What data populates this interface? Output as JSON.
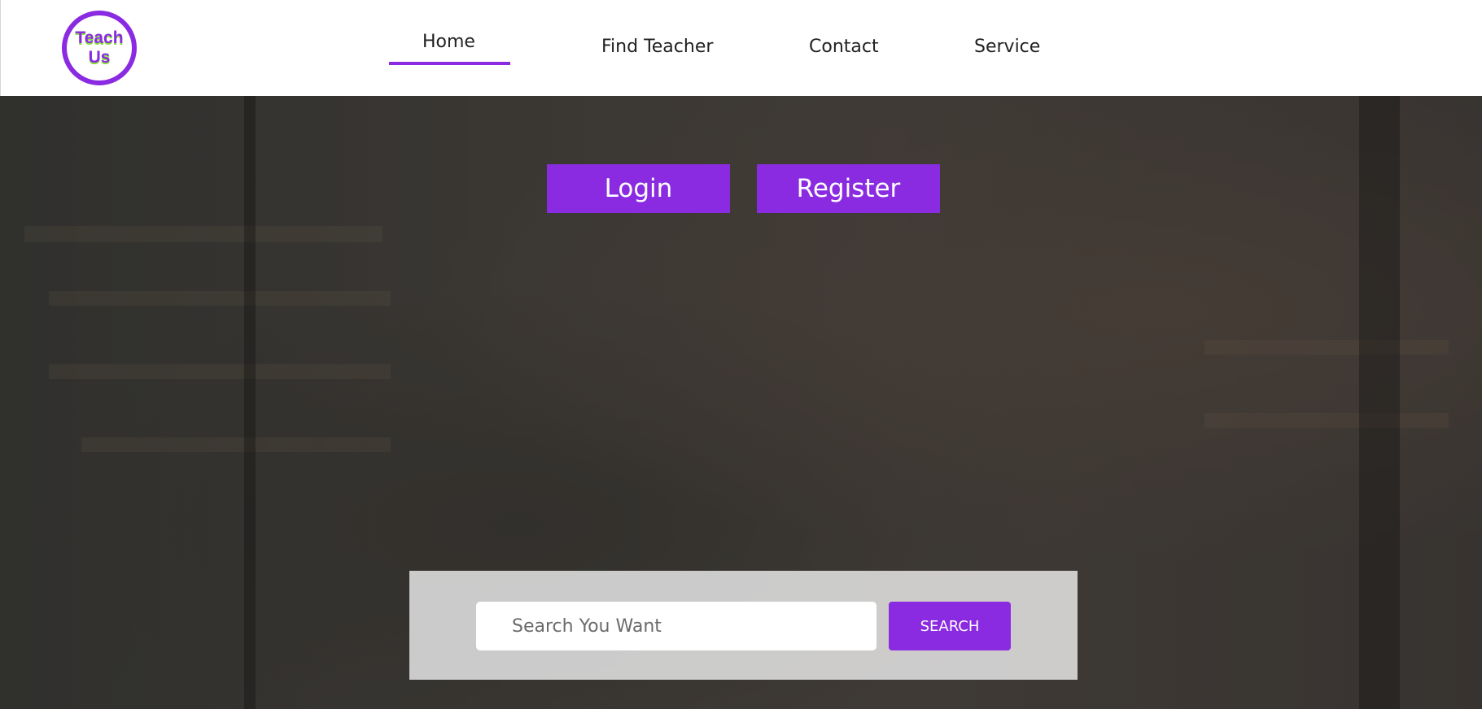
{
  "brand": {
    "logo_line1": "Teach",
    "logo_line2": "Us",
    "primary_color": "#8a2be2",
    "logo_accent_color": "#8bd93a"
  },
  "nav": {
    "items": [
      {
        "label": "Home",
        "active": true
      },
      {
        "label": "Find Teacher",
        "active": false
      },
      {
        "label": "Contact",
        "active": false
      },
      {
        "label": "Service",
        "active": false
      }
    ]
  },
  "hero": {
    "login_label": "Login",
    "register_label": "Register"
  },
  "search": {
    "placeholder": "Search You Want",
    "button_label": "SEARCH"
  }
}
